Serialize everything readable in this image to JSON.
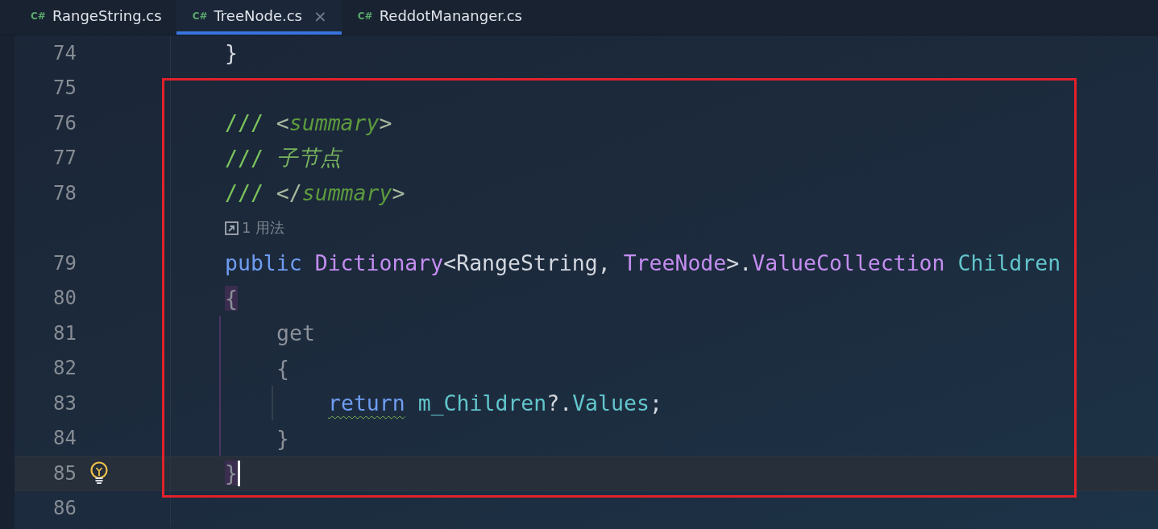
{
  "tabs": [
    {
      "icon_label": "C#",
      "label": "RangeString.cs",
      "selected": false,
      "closable": false
    },
    {
      "icon_label": "C#",
      "label": "TreeNode.cs",
      "selected": true,
      "closable": true
    },
    {
      "icon_label": "C#",
      "label": "ReddotMananger.cs",
      "selected": false,
      "closable": false
    }
  ],
  "close_glyph": "×",
  "editor": {
    "lines": [
      {
        "kind": "code",
        "number": "74",
        "current": false,
        "bulb": false,
        "tokens": [
          {
            "text": "}",
            "kind": "plain"
          }
        ]
      },
      {
        "kind": "code",
        "number": "75",
        "current": false,
        "bulb": false
      },
      {
        "kind": "code",
        "number": "76",
        "current": false,
        "bulb": false,
        "tokens": [
          {
            "text": "/// ",
            "kind": "comment"
          },
          {
            "text": "<",
            "kind": "doc-bracket"
          },
          {
            "text": "summary",
            "kind": "doc-tag"
          },
          {
            "text": ">",
            "kind": "doc-bracket"
          }
        ]
      },
      {
        "kind": "code",
        "number": "77",
        "current": false,
        "bulb": false,
        "tokens": [
          {
            "text": "/// ",
            "kind": "comment"
          },
          {
            "text": "子节点",
            "kind": "doc-text"
          }
        ]
      },
      {
        "kind": "code",
        "number": "78",
        "current": false,
        "bulb": false,
        "tokens": [
          {
            "text": "/// ",
            "kind": "comment"
          },
          {
            "text": "</",
            "kind": "doc-bracket"
          },
          {
            "text": "summary",
            "kind": "doc-tag"
          },
          {
            "text": ">",
            "kind": "doc-bracket"
          }
        ]
      },
      {
        "kind": "hint",
        "text": "1 用法"
      },
      {
        "kind": "code",
        "number": "79",
        "current": false,
        "bulb": false,
        "tokens": [
          {
            "text": "public ",
            "kind": "keyword"
          },
          {
            "text": "Dictionary",
            "kind": "type"
          },
          {
            "text": "<",
            "kind": "plain"
          },
          {
            "text": "RangeString",
            "kind": "plain"
          },
          {
            "text": ", ",
            "kind": "plain"
          },
          {
            "text": "TreeNode",
            "kind": "type"
          },
          {
            "text": ">.",
            "kind": "plain"
          },
          {
            "text": "ValueCollection ",
            "kind": "type"
          },
          {
            "text": "Children",
            "kind": "member"
          }
        ]
      },
      {
        "kind": "code",
        "number": "80",
        "current": false,
        "bulb": false,
        "tokens": [
          {
            "text": "{",
            "kind": "matched-brace"
          }
        ],
        "children": [
          {
            "kind": "code",
            "number": "81",
            "current": false,
            "bulb": false,
            "tokens": [
              {
                "text": "get",
                "kind": "dim"
              }
            ]
          },
          {
            "kind": "code",
            "number": "82",
            "current": false,
            "bulb": false,
            "tokens": [
              {
                "text": "{",
                "kind": "dim"
              }
            ],
            "children": [
              {
                "kind": "code",
                "number": "83",
                "current": false,
                "bulb": false,
                "tokens": [
                  {
                    "text": "return",
                    "kind": "keyword-warning"
                  },
                  {
                    "text": " m_Children",
                    "kind": "member"
                  },
                  {
                    "text": "?.",
                    "kind": "plain"
                  },
                  {
                    "text": "Values",
                    "kind": "member"
                  },
                  {
                    "text": ";",
                    "kind": "plain"
                  }
                ]
              }
            ]
          },
          {
            "kind": "code",
            "number": "84",
            "current": false,
            "bulb": false,
            "tokens": [
              {
                "text": "}",
                "kind": "dim"
              }
            ]
          }
        ]
      },
      {
        "kind": "code",
        "number": "85",
        "current": true,
        "bulb": true,
        "tokens": [
          {
            "text": "}",
            "kind": "matched-brace"
          }
        ]
      },
      {
        "kind": "code",
        "number": "86",
        "current": false,
        "bulb": false
      }
    ]
  }
}
